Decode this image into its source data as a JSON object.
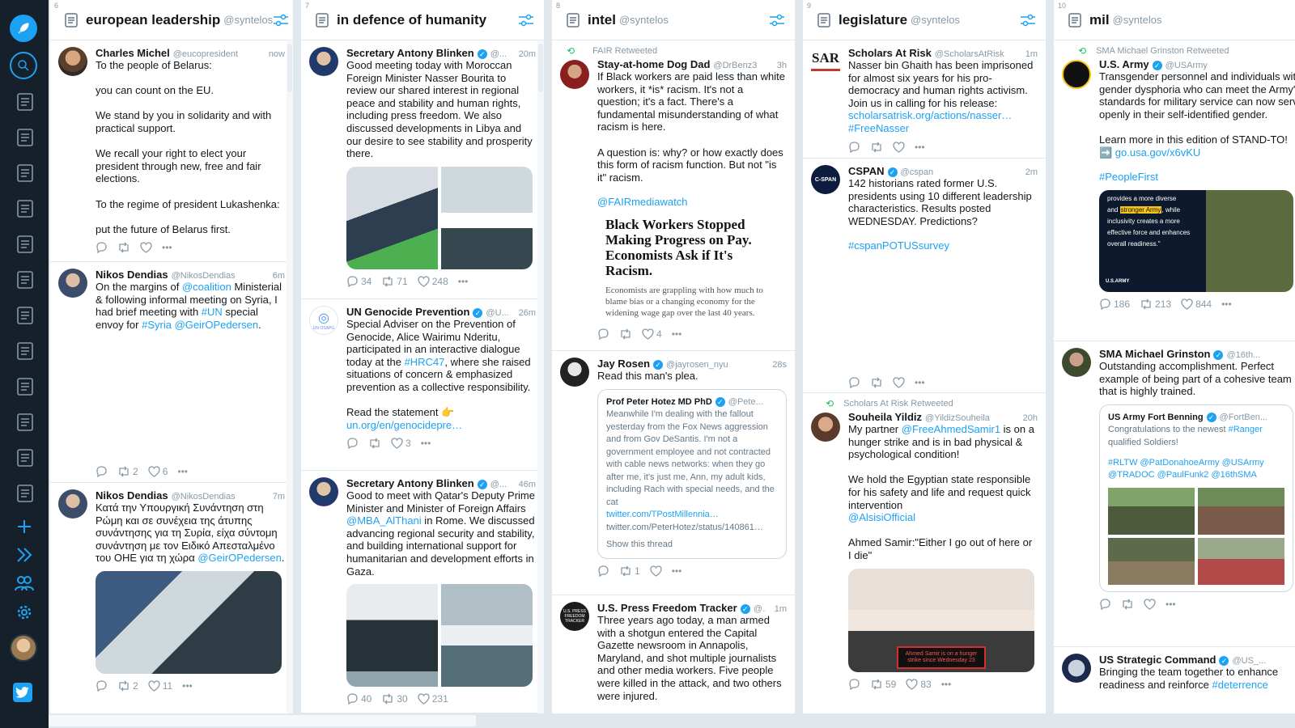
{
  "sidebar": {
    "compose_icon": "compose-feather-icon",
    "search_icon": "search-icon",
    "column_icons": [
      "column-1",
      "column-2",
      "column-3",
      "column-4",
      "column-5",
      "column-6",
      "column-7",
      "column-8",
      "column-9",
      "column-10",
      "column-11",
      "column-12"
    ],
    "add_icon": "plus-icon",
    "expand_icon": "double-chevron-icon",
    "accounts_icon": "accounts-icon",
    "settings_icon": "gear-icon",
    "twitter_icon": "twitter-bird-icon"
  },
  "colors": {
    "sidebar": "#15202b",
    "accent": "#1da1f2",
    "muted": "#8899a6",
    "retweet": "#17bf63"
  },
  "columns": [
    {
      "num": "6",
      "title": "european leadership",
      "handle": "@syntelos"
    },
    {
      "num": "7",
      "title": "in defence of humanity",
      "handle": ""
    },
    {
      "num": "8",
      "title": "intel",
      "handle": "@syntelos"
    },
    {
      "num": "9",
      "title": "legislature",
      "handle": "@syntelos"
    },
    {
      "num": "10",
      "title": "mil",
      "handle": "@syntelos"
    }
  ],
  "c1": {
    "t1": {
      "name": "Charles Michel",
      "handle": "@eucopresident",
      "time": "now",
      "text": "To the people of Belarus:\n\nyou can count on the EU.\n\nWe stand by you in solidarity and with practical support.\n\nWe recall your right to elect your president through new, free and fair elections.\n\nTo the regime of president Lukashenka:\n\nput the future of Belarus first."
    },
    "t2": {
      "name": "Nikos Dendias",
      "handle": "@NikosDendias",
      "time": "6m",
      "pre": "On the margins of ",
      "l1": "@coalition",
      "mid": " Ministerial & following informal meeting on Syria, I had brief meeting with ",
      "l2": "#UN",
      "mid2": " special envoy for ",
      "l3": "#Syria",
      "l4": "@GeirOPedersen",
      "end": ".",
      "rt": "2",
      "likes": "6"
    },
    "t3": {
      "name": "Nikos Dendias",
      "handle": "@NikosDendias",
      "time": "7m",
      "text": "Κατά την Υπουργική Συνάντηση στη Ρώμη και σε συνέχεια της άτυπης συνάντησης για τη Συρία, είχα σύντομη συνάντηση με τον Ειδικό Απεσταλμένο του ΟΗΕ για τη χώρα ",
      "l1": "@GeirOPedersen",
      "end": ".",
      "rt": "2",
      "likes": "11"
    }
  },
  "c2": {
    "t1": {
      "name": "Secretary Antony Blinken",
      "handle": "@...",
      "time": "20m",
      "text": "Good meeting today with Moroccan Foreign Minister Nasser Bourita to review our shared interest in regional peace and stability and human rights, including press freedom. We also discussed developments in Libya and our desire to see stability and prosperity there.",
      "replies": "34",
      "rt": "71",
      "likes": "248"
    },
    "t2": {
      "name": "UN Genocide Prevention",
      "handle": "@U...",
      "time": "26m",
      "text1": "Special Adviser on the Prevention of Genocide, Alice Wairimu Nderitu, participated in an interactive dialogue today at the ",
      "l1": "#HRC47",
      "text2": ", where she raised situations of concern & emphasized prevention as a collective responsibility.\n\nRead the statement 👉",
      "l2": "un.org/en/genocidepre…",
      "likes": "3",
      "avatar_label": "UN OSAPG"
    },
    "t3": {
      "name": "Secretary Antony Blinken",
      "handle": "@...",
      "time": "46m",
      "text1": "Good to meet with Qatar's Deputy Prime Minister and Minister of Foreign Affairs ",
      "l1": "@MBA_AlThani",
      "text2": " in Rome. We discussed advancing regional security and stability, and building international support for humanitarian and development efforts in Gaza.",
      "replies": "40",
      "rt": "30",
      "likes": "231"
    }
  },
  "c3": {
    "t1": {
      "rt_by": "FAIR Retweeted",
      "name": "Stay-at-home Dog Dad",
      "handle": "@DrBenz3",
      "time": "3h",
      "text": "If Black workers are paid less than white workers, it *is* racism. It's not a question; it's a fact. There's a fundamental misunderstanding of what racism is here.\n\nA question is: why? or how exactly does this form of racism function. But not \"is it\" racism.",
      "l1": "@FAIRmediawatch",
      "card_title": "Black Workers Stopped Making Progress on Pay. Economists Ask if It's Racism.",
      "card_sub": "Economists are grappling with how much to blame bias or a changing economy for the widening wage gap over the last 40 years.",
      "likes": "4"
    },
    "t2": {
      "name": "Jay Rosen",
      "handle": "@jayrosen_nyu",
      "time": "28s",
      "text": "Read this man's plea.",
      "q_name": "Prof Peter Hotez MD PhD",
      "q_handle": "@Pete...",
      "q_text": "Meanwhile I'm dealing with the fallout yesterday from the Fox News aggression and from Gov DeSantis. I'm not a government employee and not contracted with cable news networks: when they go after me, it's just me, Ann, my adult kids, including Rach with special needs, and the cat",
      "q_link": "twitter.com/TPostMillennia…",
      "q_link2": "twitter.com/PeterHotez/status/140861…",
      "q_thread": "Show this thread",
      "rt": "1"
    },
    "t3": {
      "name": "U.S. Press Freedom Tracker",
      "handle": "@...",
      "time": "1m",
      "text": "Three years ago today, a man armed with a shotgun entered the Capital Gazette newsroom in Annapolis, Maryland, and shot multiple journalists and other media workers. Five people were killed in the attack, and two others were injured.",
      "avatar_label": "U.S. PRESS FREEDOM TRACKER"
    }
  },
  "c4": {
    "t1": {
      "name": "Scholars At Risk",
      "handle": "@ScholarsAtRisk",
      "time": "1m",
      "text": "Nasser bin Ghaith has been imprisoned for almost six years for his pro-democracy and human rights activism. Join us in calling for his release:",
      "l1": "scholarsatrisk.org/actions/nasser…",
      "l2": "#FreeNasser",
      "avatar_label": "SAR"
    },
    "t2": {
      "name": "CSPAN",
      "handle": "@cspan",
      "time": "2m",
      "text": "142 historians rated former U.S. presidents using 10 different leadership characteristics. Results posted WEDNESDAY. Predictions?",
      "l1": "#cspanPOTUSsurvey",
      "avatar_label": "C-SPAN"
    },
    "t3": {
      "rt_by": "Scholars At Risk Retweeted",
      "name": "Souheila Yildiz",
      "handle": "@YildizSouheila",
      "time": "20h",
      "pre": "My partner ",
      "l1": "@FreeAhmedSamir1",
      "text": " is on a hunger strike and is in bad physical & psychological condition!\n\nWe hold the Egyptian state responsible for his safety and life and request quick intervention",
      "l2": "@AlsisiOfficial",
      "text2": "Ahmed Samir:\"Either I go out of here or I die\"",
      "sign": "Ahmed Samir is on a hunger strike since Wednesday 23",
      "rt": "59",
      "likes": "83"
    }
  },
  "c5": {
    "t1": {
      "rt_by": "SMA Michael Grinston Retweeted",
      "name": "U.S. Army",
      "handle": "@USArmy",
      "text": "Transgender personnel and individuals with gender dysphoria who can meet the Army's standards for military service can now serve openly in their self-identified gender.\n\nLearn more in this edition of STAND-TO!",
      "l1": "➡️ go.usa.gov/x6vKU",
      "l2": "#PeopleFirst",
      "img_t1": "provides a more diverse",
      "img_t2": "and ",
      "img_hl": "stronger Army",
      "img_t3": ", while",
      "img_t4": "inclusivity creates a more",
      "img_t5": "effective force and enhances",
      "img_t6": "overall readiness.\"",
      "img_badge": "U.S.ARMY",
      "replies": "186",
      "rt": "213",
      "likes": "844"
    },
    "t2": {
      "name": "SMA Michael Grinston",
      "handle": "@16th...",
      "text": "Outstanding accomplishment. Perfect example of being part of a cohesive team that is highly trained.",
      "q_name": "US Army Fort Benning",
      "q_handle": "@FortBen...",
      "q_text": "Congratulations to the newest ",
      "q_l1": "#Ranger",
      "q_text2": " qualified Soldiers!",
      "q_tags": "#RLTW @PatDonahoeArmy @USArmy @TRADOC @PaulFunk2 @16thSMA"
    },
    "t3": {
      "name": "US Strategic Command",
      "handle": "@US_...",
      "text": "Bringing the team together to enhance readiness and reinforce ",
      "l1": "#deterrence"
    }
  }
}
